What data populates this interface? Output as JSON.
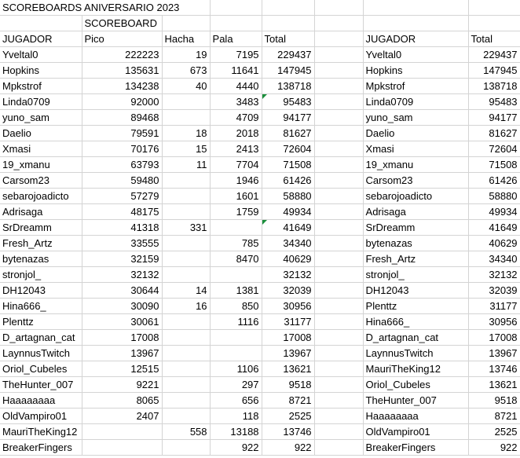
{
  "title": "SCOREBOARDS ANIVERSARIO 2023",
  "subtitle": "SCOREBOARD",
  "colors": {
    "gridline": "#d4d4d4",
    "indicator": "#1b8f3c"
  },
  "left_headers": [
    "JUGADOR",
    "Pico",
    "Hacha",
    "Pala",
    "Total"
  ],
  "right_headers": [
    "JUGADOR",
    "Total"
  ],
  "left_rows": [
    [
      "Yveltal0",
      "222223",
      "19",
      "7195",
      "229437"
    ],
    [
      "Hopkins",
      "135631",
      "673",
      "11641",
      "147945"
    ],
    [
      "Mpkstrof",
      "134238",
      "40",
      "4440",
      "138718"
    ],
    [
      "Linda0709",
      "92000",
      "",
      "3483",
      "95483"
    ],
    [
      "yuno_sam",
      "89468",
      "",
      "4709",
      "94177"
    ],
    [
      "Daelio",
      "79591",
      "18",
      "2018",
      "81627"
    ],
    [
      "Xmasi",
      "70176",
      "15",
      "2413",
      "72604"
    ],
    [
      "19_xmanu",
      "63793",
      "11",
      "7704",
      "71508"
    ],
    [
      "Carsom23",
      "59480",
      "",
      "1946",
      "61426"
    ],
    [
      "sebarojoadicto",
      "57279",
      "",
      "1601",
      "58880"
    ],
    [
      "Adrisaga",
      "48175",
      "",
      "1759",
      "49934"
    ],
    [
      "SrDreamm",
      "41318",
      "331",
      "",
      "41649"
    ],
    [
      "Fresh_Artz",
      "33555",
      "",
      "785",
      "34340"
    ],
    [
      "bytenazas",
      "32159",
      "",
      "8470",
      "40629"
    ],
    [
      "stronjol_",
      "32132",
      "",
      "",
      "32132"
    ],
    [
      "DH12043",
      "30644",
      "14",
      "1381",
      "32039"
    ],
    [
      "Hina666_",
      "30090",
      "16",
      "850",
      "30956"
    ],
    [
      "Plenttz",
      "30061",
      "",
      "1116",
      "31177"
    ],
    [
      "D_artagnan_cat",
      "17008",
      "",
      "",
      "17008"
    ],
    [
      "LaynnusTwitch",
      "13967",
      "",
      "",
      "13967"
    ],
    [
      "Oriol_Cubeles",
      "12515",
      "",
      "1106",
      "13621"
    ],
    [
      "TheHunter_007",
      "9221",
      "",
      "297",
      "9518"
    ],
    [
      "Haaaaaaaa",
      "8065",
      "",
      "656",
      "8721"
    ],
    [
      "OldVampiro01",
      "2407",
      "",
      "118",
      "2525"
    ],
    [
      "MauriTheKing12",
      "",
      "558",
      "13188",
      "13746"
    ],
    [
      "BreakerFingers",
      "",
      "",
      "922",
      "922"
    ]
  ],
  "right_rows": [
    [
      "Yveltal0",
      "229437"
    ],
    [
      "Hopkins",
      "147945"
    ],
    [
      "Mpkstrof",
      "138718"
    ],
    [
      "Linda0709",
      "95483"
    ],
    [
      "yuno_sam",
      "94177"
    ],
    [
      "Daelio",
      "81627"
    ],
    [
      "Xmasi",
      "72604"
    ],
    [
      "19_xmanu",
      "71508"
    ],
    [
      "Carsom23",
      "61426"
    ],
    [
      "sebarojoadicto",
      "58880"
    ],
    [
      "Adrisaga",
      "49934"
    ],
    [
      "SrDreamm",
      "41649"
    ],
    [
      "bytenazas",
      "40629"
    ],
    [
      "Fresh_Artz",
      "34340"
    ],
    [
      "stronjol_",
      "32132"
    ],
    [
      "DH12043",
      "32039"
    ],
    [
      "Plenttz",
      "31177"
    ],
    [
      "Hina666_",
      "30956"
    ],
    [
      "D_artagnan_cat",
      "17008"
    ],
    [
      "LaynnusTwitch",
      "13967"
    ],
    [
      "MauriTheKing12",
      "13746"
    ],
    [
      "Oriol_Cubeles",
      "13621"
    ],
    [
      "TheHunter_007",
      "9518"
    ],
    [
      "Haaaaaaaa",
      "8721"
    ],
    [
      "OldVampiro01",
      "2525"
    ],
    [
      "BreakerFingers",
      "922"
    ]
  ]
}
